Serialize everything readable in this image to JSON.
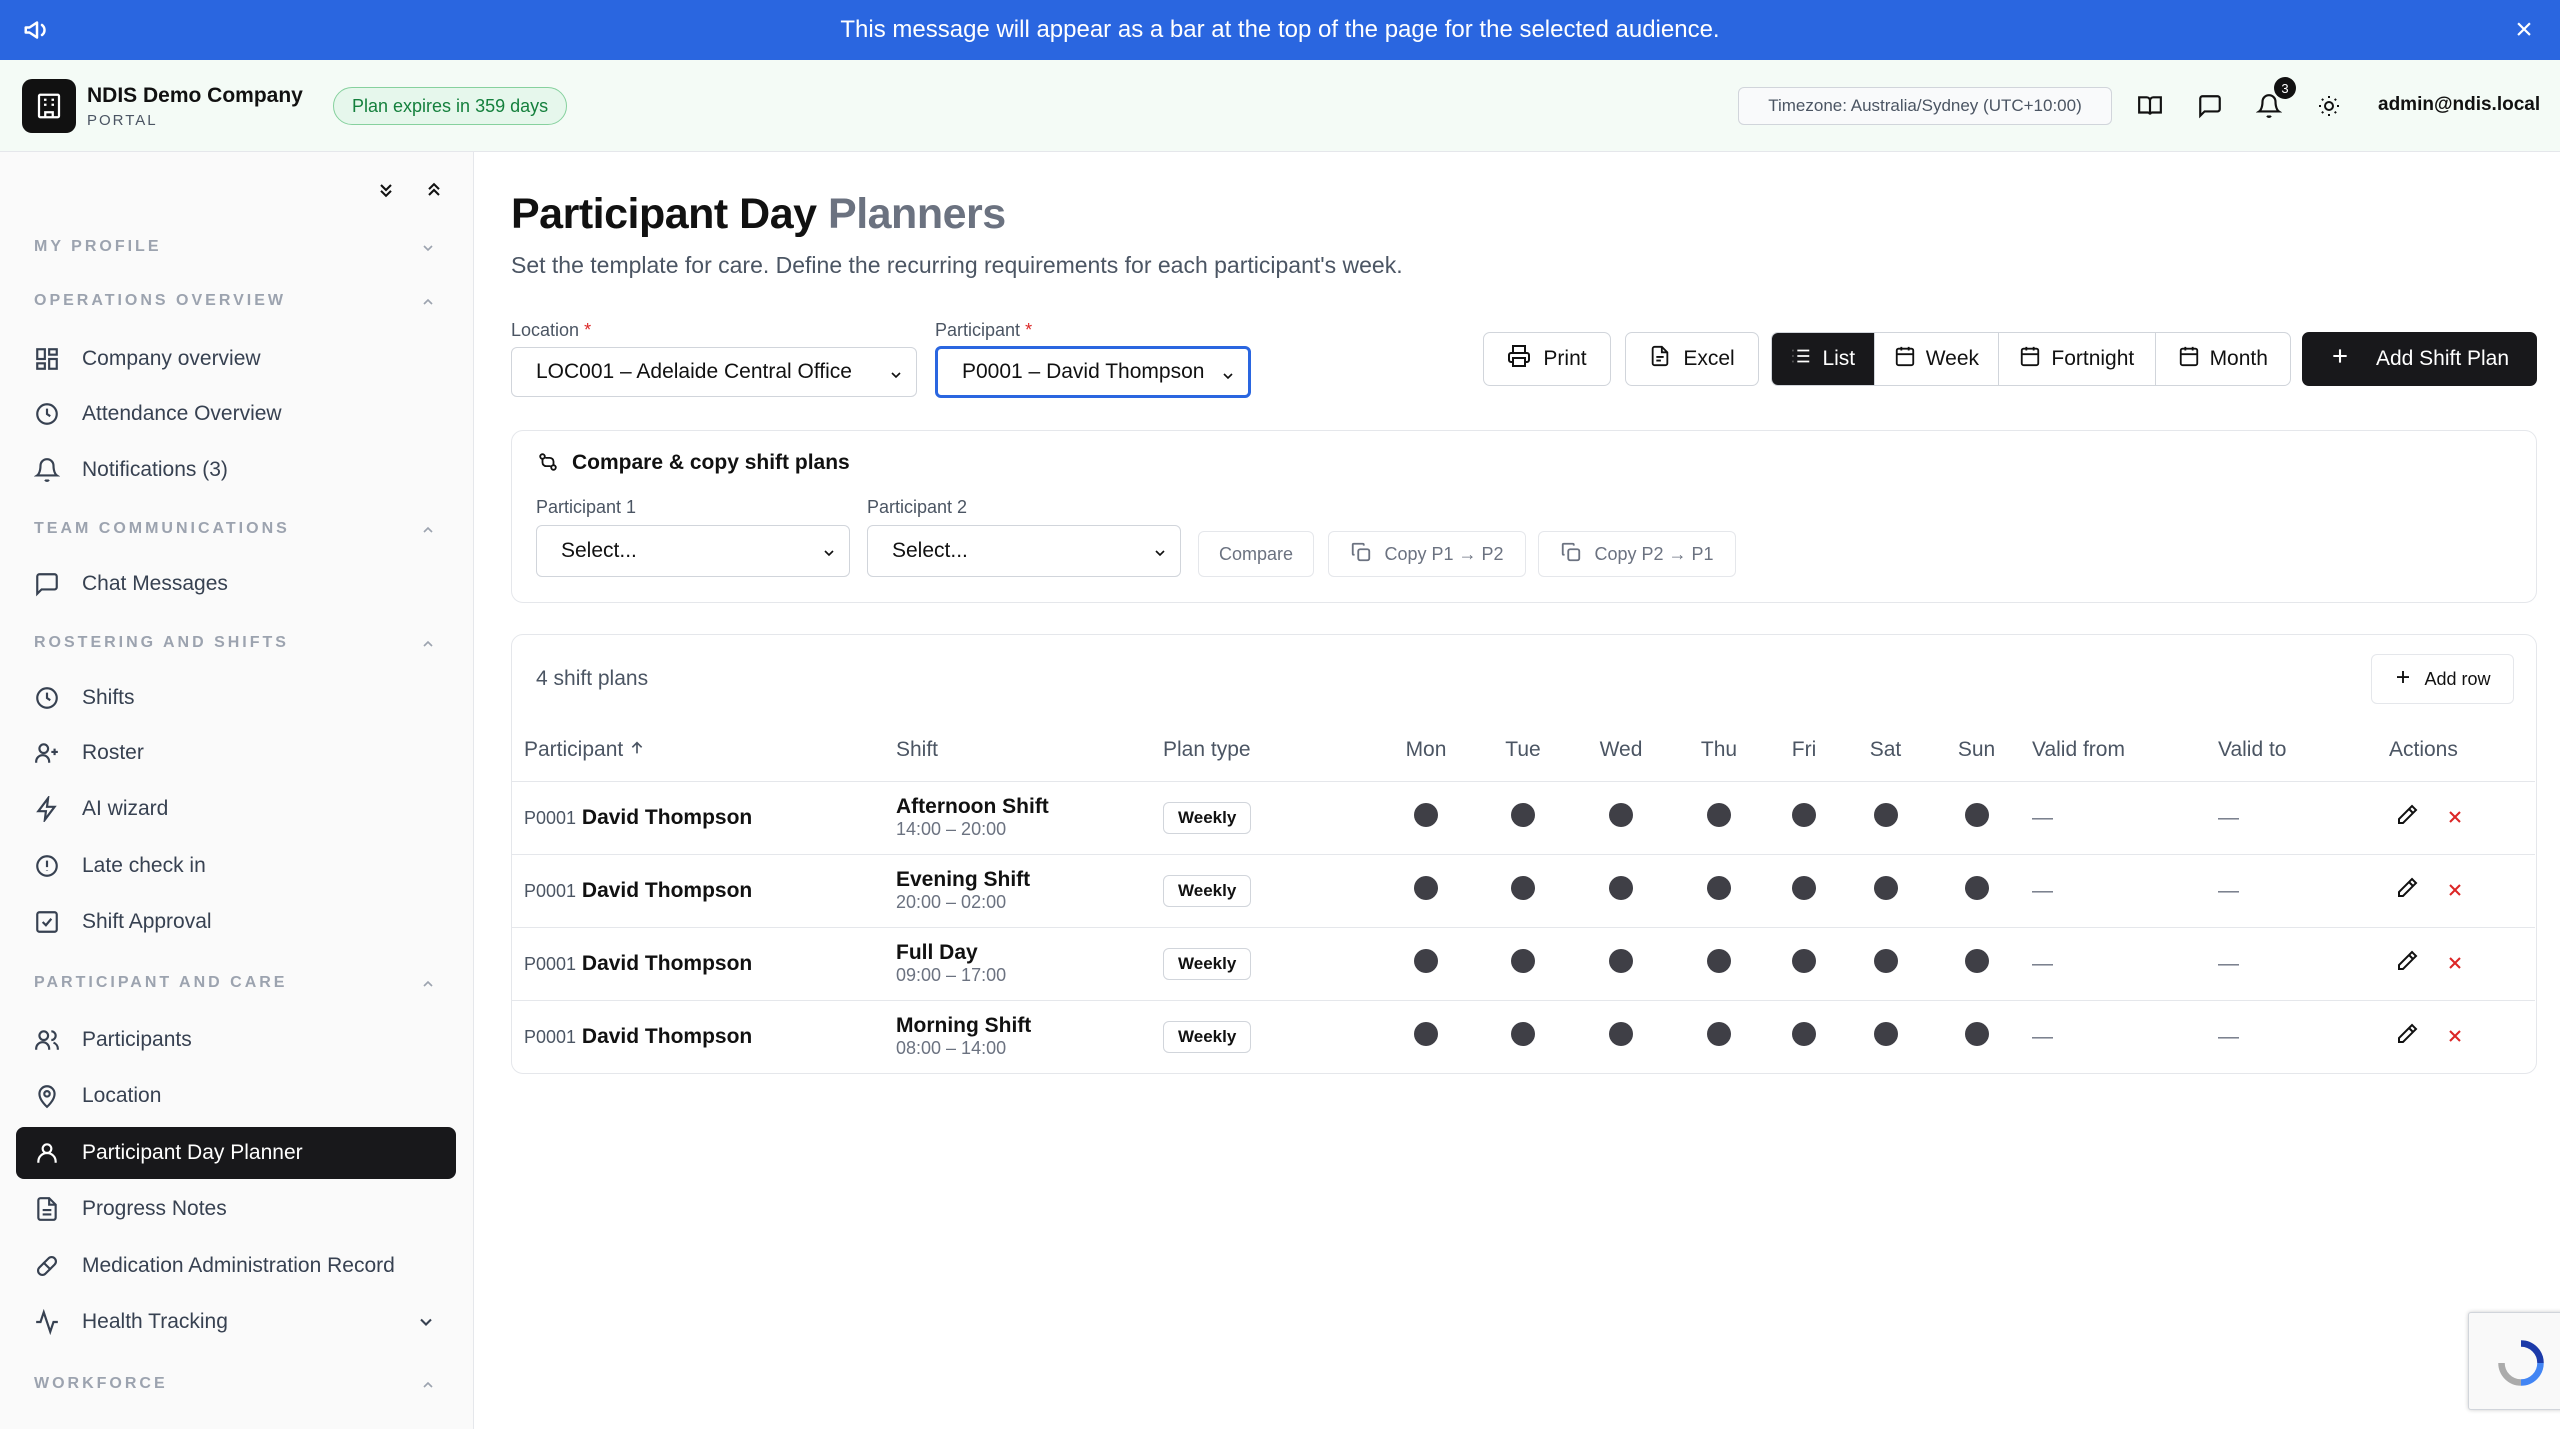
{
  "announcement": {
    "text": "This message will appear as a bar at the top of the page for the selected audience."
  },
  "header": {
    "company": "NDIS Demo Company",
    "portal": "PORTAL",
    "plan_badge": "Plan expires in 359 days",
    "timezone": "Timezone: Australia/Sydney (UTC+10:00)",
    "notification_count": "3",
    "user": "admin@ndis.local"
  },
  "sidebar": {
    "sections": {
      "my_profile": "MY PROFILE",
      "operations": "OPERATIONS OVERVIEW",
      "team": "TEAM COMMUNICATIONS",
      "rostering": "ROSTERING AND SHIFTS",
      "participant_care": "PARTICIPANT AND CARE",
      "workforce": "WORKFORCE"
    },
    "items": {
      "company_overview": "Company overview",
      "attendance": "Attendance Overview",
      "notifications": "Notifications (3)",
      "chat": "Chat Messages",
      "shifts": "Shifts",
      "roster": "Roster",
      "ai_wizard": "AI wizard",
      "late_checkin": "Late check in",
      "shift_approval": "Shift Approval",
      "participants": "Participants",
      "location": "Location",
      "day_planner": "Participant Day Planner",
      "progress_notes": "Progress Notes",
      "medication": "Medication Administration Record",
      "health": "Health Tracking"
    }
  },
  "page": {
    "title_a": "Participant Day",
    "title_b": "Planners",
    "subtitle": "Set the template for care. Define the recurring requirements for each participant's week."
  },
  "filters": {
    "location_label": "Location",
    "location_value": "LOC001 – Adelaide Central Office",
    "participant_label": "Participant",
    "participant_value": "P0001 – David Thompson",
    "required_mark": "*"
  },
  "toolbar": {
    "print": "Print",
    "excel": "Excel",
    "views": [
      "List",
      "Week",
      "Fortnight",
      "Month"
    ],
    "active_view": "List",
    "add_plan": "Add Shift Plan"
  },
  "compare": {
    "title": "Compare & copy shift plans",
    "p1_label": "Participant 1",
    "p2_label": "Participant 2",
    "p1_value": "Select...",
    "p2_value": "Select...",
    "compare_btn": "Compare",
    "copy_p1_p2": "Copy P1 → P2",
    "copy_p2_p1": "Copy P2 → P1"
  },
  "plans": {
    "count_label": "4 shift plans",
    "add_row": "Add row",
    "columns": [
      "Participant",
      "Shift",
      "Plan type",
      "Mon",
      "Tue",
      "Wed",
      "Thu",
      "Fri",
      "Sat",
      "Sun",
      "Valid from",
      "Valid to",
      "Actions"
    ],
    "rows": [
      {
        "code": "P0001",
        "name": "David Thompson",
        "shift": "Afternoon Shift",
        "time": "14:00 – 20:00",
        "type": "Weekly",
        "valid_from": "—",
        "valid_to": "—"
      },
      {
        "code": "P0001",
        "name": "David Thompson",
        "shift": "Evening Shift",
        "time": "20:00 – 02:00",
        "type": "Weekly",
        "valid_from": "—",
        "valid_to": "—"
      },
      {
        "code": "P0001",
        "name": "David Thompson",
        "shift": "Full Day",
        "time": "09:00 – 17:00",
        "type": "Weekly",
        "valid_from": "—",
        "valid_to": "—"
      },
      {
        "code": "P0001",
        "name": "David Thompson",
        "shift": "Morning Shift",
        "time": "08:00 – 14:00",
        "type": "Weekly",
        "valid_from": "—",
        "valid_to": "—"
      }
    ]
  },
  "colors": {
    "accent": "#2a66e0",
    "dark": "#18181b",
    "danger": "#dc2626",
    "success": "#15803d"
  }
}
